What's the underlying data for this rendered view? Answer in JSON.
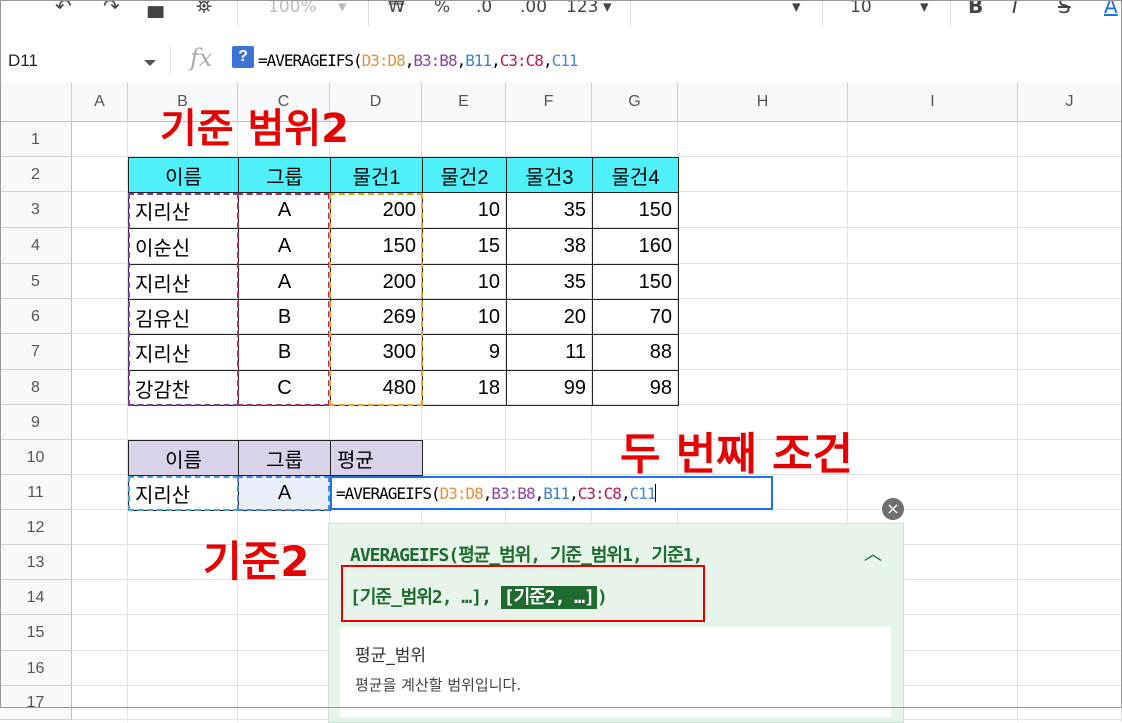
{
  "toolbar": {
    "undo_icon": "undo-icon",
    "redo_icon": "redo-icon",
    "print_icon": "print-icon",
    "paint_format_icon": "paint-format-icon",
    "zoom": "100%",
    "currency": "₩",
    "percent": "%",
    "dec_decrease": ".0",
    "dec_increase": ".00",
    "more_formats": "123",
    "font_size": "10",
    "bold": "B",
    "italic": "I",
    "strike": "S",
    "text_color": "A"
  },
  "formula_bar": {
    "name_box": "D11",
    "fx": "fx",
    "help": "?",
    "formula_prefix": "=AVERAGEIFS(",
    "args": [
      {
        "text": "D3:D8",
        "color": "#e69138"
      },
      {
        "text": "B3:B8",
        "color": "#8e44ad"
      },
      {
        "text": "B11",
        "color": "#3d85c6"
      },
      {
        "text": "C3:C8",
        "color": "#c2185b"
      },
      {
        "text": "C11",
        "color": "#4a86e8"
      }
    ],
    "comma": ","
  },
  "columns": [
    "A",
    "B",
    "C",
    "D",
    "E",
    "F",
    "G",
    "H",
    "I",
    "J"
  ],
  "rows": [
    "1",
    "2",
    "3",
    "4",
    "5",
    "6",
    "7",
    "8",
    "9",
    "10",
    "11",
    "12",
    "13",
    "14",
    "15",
    "16",
    "17"
  ],
  "table1": {
    "headers": [
      "이름",
      "그룹",
      "물건1",
      "물건2",
      "물건3",
      "물건4"
    ],
    "rows": [
      [
        "지리산",
        "A",
        "200",
        "10",
        "35",
        "150"
      ],
      [
        "이순신",
        "A",
        "150",
        "15",
        "38",
        "160"
      ],
      [
        "지리산",
        "A",
        "200",
        "10",
        "35",
        "150"
      ],
      [
        "김유신",
        "B",
        "269",
        "10",
        "20",
        "70"
      ],
      [
        "지리산",
        "B",
        "300",
        "9",
        "11",
        "88"
      ],
      [
        "강감찬",
        "C",
        "480",
        "18",
        "99",
        "98"
      ]
    ]
  },
  "table2": {
    "headers": [
      "이름",
      "그룹",
      "평균"
    ],
    "row": [
      "지리산",
      "A"
    ]
  },
  "annotations": {
    "range2": "기준 범위2",
    "second_condition": "두 번째 조건",
    "criteria2": "기준2"
  },
  "popup": {
    "sig_line1": "AVERAGEIFS(평균_범위, 기준_범위1, 기준1,",
    "sig_line2_a": "[기준_범위2, …], ",
    "sig_line2_hl": "[기준2, …]",
    "sig_line2_b": ")",
    "param_title": "평균_범위",
    "param_desc": "평균을 계산할 범위입니다.",
    "close": "×",
    "collapse": "^"
  },
  "colors": {
    "header1_bg": "#4ff0f7",
    "header2_bg": "#d9d2e9",
    "annotation": "#e60000",
    "popup_bg": "#e6f4ea",
    "popup_text": "#1d6b2e",
    "selection": "#1a73e8"
  }
}
